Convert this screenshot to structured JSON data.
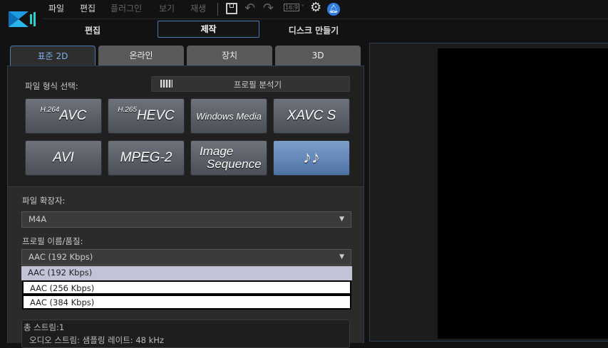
{
  "menu": [
    "파일",
    "편집",
    "플러그인",
    "보기",
    "재생"
  ],
  "toolbar": {
    "aspect": "16:9"
  },
  "modes": [
    "편집",
    "제작",
    "디스크 만들기"
  ],
  "tabs": [
    "표준 2D",
    "온라인",
    "장치",
    "3D"
  ],
  "format_label": "파일 형식 선택:",
  "profile_analyzer": "프로필 분석기",
  "formats": [
    {
      "sup": "H.264",
      "name": "AVC"
    },
    {
      "sup": "H.265",
      "name": "HEVC"
    },
    {
      "name": "Windows Media"
    },
    {
      "name": "XAVC S"
    },
    {
      "name": "AVI"
    },
    {
      "name": "MPEG-2"
    },
    {
      "name": "Image Sequence",
      "line1": "Image",
      "line2": "Sequence"
    },
    {
      "name": "♪♪"
    }
  ],
  "ext_label": "파일 확장자:",
  "ext_value": "M4A",
  "profile_label": "프로필 이름/품질:",
  "profile_value": "AAC (192 Kbps)",
  "profile_options": [
    "AAC (192 Kbps)",
    "AAC (256 Kbps)",
    "AAC (384 Kbps)"
  ],
  "info": {
    "line1": "총 스트림:1",
    "line2": "오디오 스트림: 샘플링 레이트: 48 kHz"
  },
  "colors": {
    "accent": "#4a78b0",
    "selected": "#c0c4d6"
  }
}
